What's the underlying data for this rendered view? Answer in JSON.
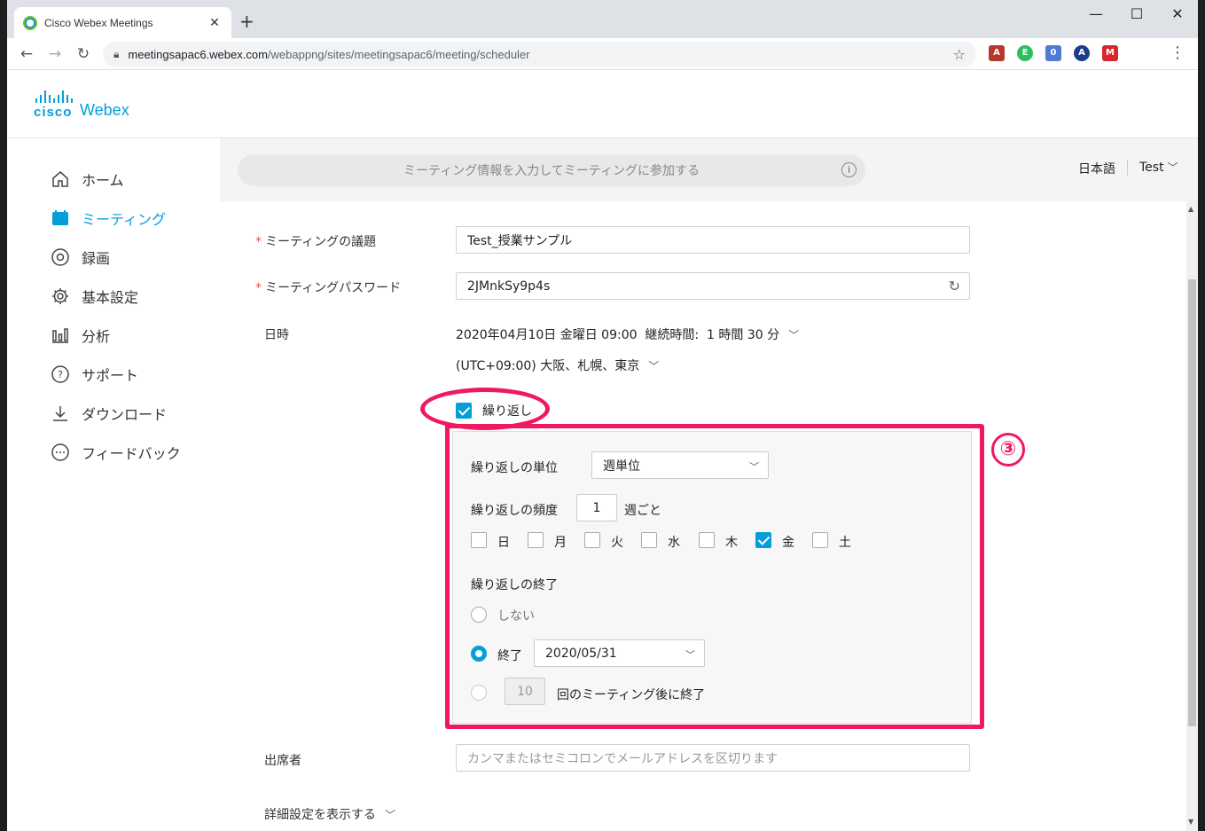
{
  "browser": {
    "tab_title": "Cisco Webex Meetings",
    "url_host": "meetingsapac6.webex.com",
    "url_path": "/webappng/sites/meetingsapac6/meeting/scheduler"
  },
  "logo": {
    "brand": "cisco",
    "product": "Webex"
  },
  "sidebar": {
    "items": [
      {
        "label": "ホーム",
        "icon": "home-icon",
        "active": false
      },
      {
        "label": "ミーティング",
        "icon": "calendar-icon",
        "active": true
      },
      {
        "label": "録画",
        "icon": "record-icon",
        "active": false
      },
      {
        "label": "基本設定",
        "icon": "gear-icon",
        "active": false
      },
      {
        "label": "分析",
        "icon": "chart-icon",
        "active": false
      },
      {
        "label": "サポート",
        "icon": "help-icon",
        "active": false
      },
      {
        "label": "ダウンロード",
        "icon": "download-icon",
        "active": false
      },
      {
        "label": "フィードバック",
        "icon": "chat-icon",
        "active": false
      }
    ]
  },
  "header": {
    "search_placeholder": "ミーティング情報を入力してミーティングに参加する",
    "language": "日本語",
    "user": "Test"
  },
  "form": {
    "topic_label": "ミーティングの議題",
    "topic_value": "Test_授業サンプル",
    "password_label": "ミーティングパスワード",
    "password_value": "2JMnkSy9p4s",
    "datetime_label": "日時",
    "datetime_value": "2020年04月10日 金曜日 09:00",
    "duration_label": "継続時間:",
    "duration_value": "1 時間 30 分",
    "timezone": "(UTC+09:00) 大阪、札幌、東京",
    "repeat_label": "繰り返し",
    "repeat_checked": true,
    "recurrence": {
      "unit_label": "繰り返しの単位",
      "unit_value": "週単位",
      "frequency_label": "繰り返しの頻度",
      "frequency_value": "1",
      "frequency_suffix": "週ごと",
      "days": [
        {
          "label": "日",
          "checked": false
        },
        {
          "label": "月",
          "checked": false
        },
        {
          "label": "火",
          "checked": false
        },
        {
          "label": "水",
          "checked": false
        },
        {
          "label": "木",
          "checked": false
        },
        {
          "label": "金",
          "checked": true
        },
        {
          "label": "土",
          "checked": false
        }
      ],
      "end_label": "繰り返しの終了",
      "end_never": "しない",
      "end_date_label": "終了",
      "end_date_value": "2020/05/31",
      "end_after_count": "10",
      "end_after_label": "回のミーティング後に終了",
      "selected_end": "date"
    },
    "attendees_label": "出席者",
    "attendees_placeholder": "カンマまたはセミコロンでメールアドレスを区切ります",
    "advanced_label": "詳細設定を表示する"
  },
  "annotation": {
    "badge": "③",
    "color": "#f0195f"
  },
  "colors": {
    "accent": "#049fd9",
    "annotation": "#f0195f"
  }
}
